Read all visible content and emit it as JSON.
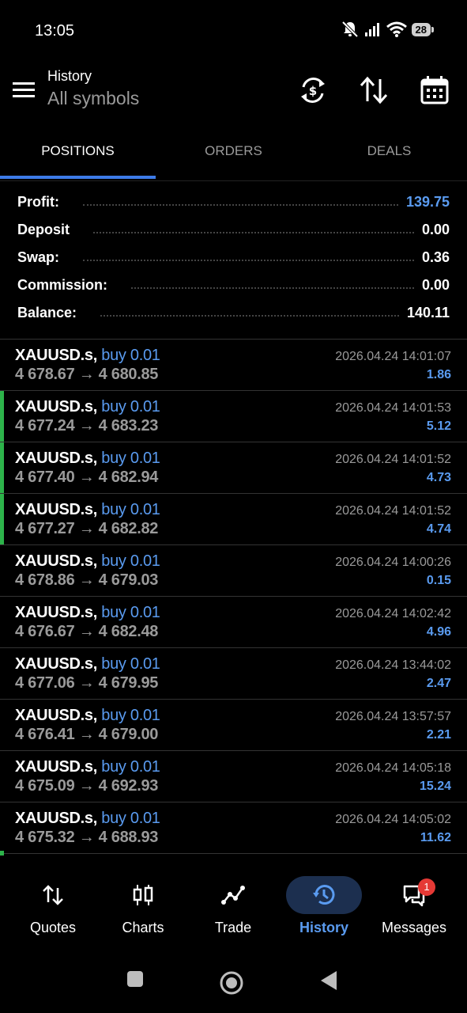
{
  "status": {
    "time": "13:05",
    "battery": "28"
  },
  "header": {
    "title": "History",
    "subtitle": "All symbols"
  },
  "tabs": [
    {
      "label": "POSITIONS",
      "active": true
    },
    {
      "label": "ORDERS",
      "active": false
    },
    {
      "label": "DEALS",
      "active": false
    }
  ],
  "summary": {
    "profit": {
      "label": "Profit:",
      "value": "139.75"
    },
    "deposit": {
      "label": "Deposit",
      "value": "0.00"
    },
    "swap": {
      "label": "Swap:",
      "value": "0.36"
    },
    "commission": {
      "label": "Commission:",
      "value": "0.00"
    },
    "balance": {
      "label": "Balance:",
      "value": "140.11"
    }
  },
  "positions": [
    {
      "symbol": "XAUUSD.s,",
      "direction": "buy 0.01",
      "prices": "4 678.67 → 4 680.85",
      "time": "2026.04.24 14:01:07",
      "profit": "1.86",
      "highlight": false
    },
    {
      "symbol": "XAUUSD.s,",
      "direction": "buy 0.01",
      "prices": "4 677.24 → 4 683.23",
      "time": "2026.04.24 14:01:53",
      "profit": "5.12",
      "highlight": true
    },
    {
      "symbol": "XAUUSD.s,",
      "direction": "buy 0.01",
      "prices": "4 677.40 → 4 682.94",
      "time": "2026.04.24 14:01:52",
      "profit": "4.73",
      "highlight": true
    },
    {
      "symbol": "XAUUSD.s,",
      "direction": "buy 0.01",
      "prices": "4 677.27 → 4 682.82",
      "time": "2026.04.24 14:01:52",
      "profit": "4.74",
      "highlight": true
    },
    {
      "symbol": "XAUUSD.s,",
      "direction": "buy 0.01",
      "prices": "4 678.86 → 4 679.03",
      "time": "2026.04.24 14:00:26",
      "profit": "0.15",
      "highlight": false
    },
    {
      "symbol": "XAUUSD.s,",
      "direction": "buy 0.01",
      "prices": "4 676.67 → 4 682.48",
      "time": "2026.04.24 14:02:42",
      "profit": "4.96",
      "highlight": false
    },
    {
      "symbol": "XAUUSD.s,",
      "direction": "buy 0.01",
      "prices": "4 677.06 → 4 679.95",
      "time": "2026.04.24 13:44:02",
      "profit": "2.47",
      "highlight": false
    },
    {
      "symbol": "XAUUSD.s,",
      "direction": "buy 0.01",
      "prices": "4 676.41 → 4 679.00",
      "time": "2026.04.24 13:57:57",
      "profit": "2.21",
      "highlight": false
    },
    {
      "symbol": "XAUUSD.s,",
      "direction": "buy 0.01",
      "prices": "4 675.09 → 4 692.93",
      "time": "2026.04.24 14:05:18",
      "profit": "15.24",
      "highlight": false
    },
    {
      "symbol": "XAUUSD.s,",
      "direction": "buy 0.01",
      "prices": "4 675.32 → 4 688.93",
      "time": "2026.04.24 14:05:02",
      "profit": "11.62",
      "highlight": false
    }
  ],
  "bottom_nav": [
    {
      "label": "Quotes",
      "icon": "quotes-icon",
      "active": false
    },
    {
      "label": "Charts",
      "icon": "charts-icon",
      "active": false
    },
    {
      "label": "Trade",
      "icon": "trade-icon",
      "active": false
    },
    {
      "label": "History",
      "icon": "history-icon",
      "active": true
    },
    {
      "label": "Messages",
      "icon": "messages-icon",
      "active": false,
      "badge": "1"
    }
  ],
  "colors": {
    "accent": "#5a9bf0",
    "highlight": "#2db34a",
    "active_tab_underline": "#3d7be8",
    "badge": "#e53935"
  }
}
